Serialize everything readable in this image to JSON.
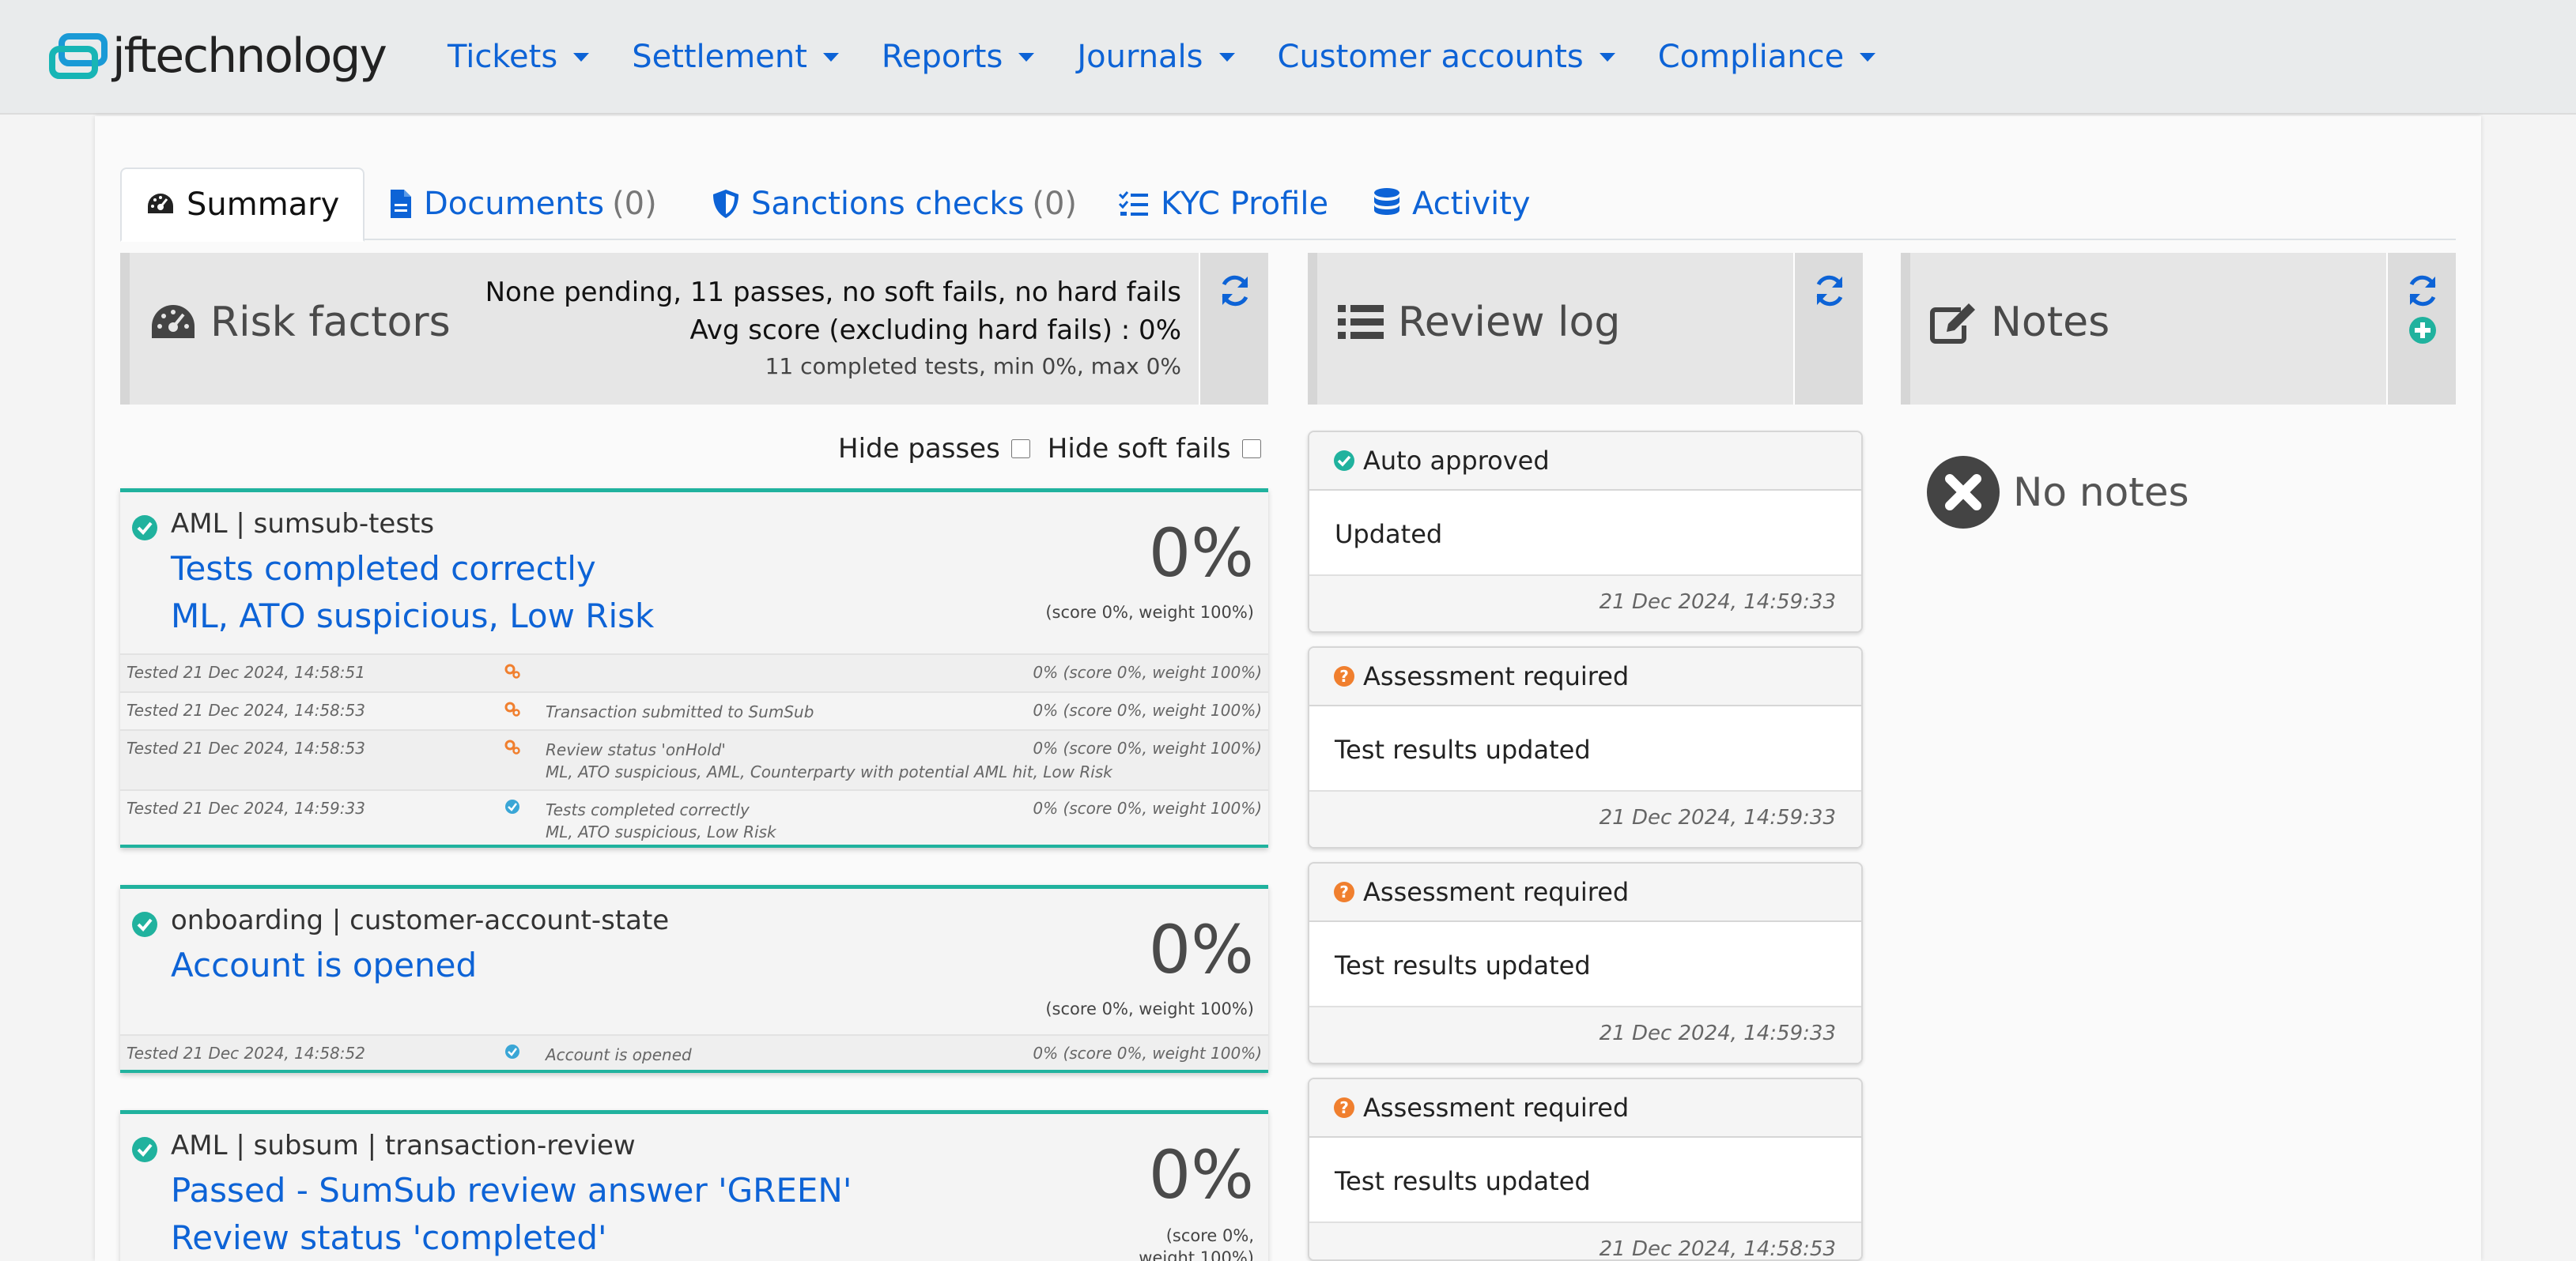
{
  "brand": {
    "name": "jftechnology"
  },
  "nav": {
    "items": [
      {
        "label": "Tickets"
      },
      {
        "label": "Settlement"
      },
      {
        "label": "Reports"
      },
      {
        "label": "Journals"
      },
      {
        "label": "Customer accounts"
      },
      {
        "label": "Compliance"
      }
    ]
  },
  "tabs": [
    {
      "label": "Summary",
      "icon": "tachometer-icon",
      "count": ""
    },
    {
      "label": "Documents",
      "icon": "file-icon",
      "count": "(0)"
    },
    {
      "label": "Sanctions checks",
      "icon": "shield-icon",
      "count": "(0)"
    },
    {
      "label": "KYC Profile",
      "icon": "checklist-icon",
      "count": ""
    },
    {
      "label": "Activity",
      "icon": "database-icon",
      "count": ""
    }
  ],
  "risk": {
    "title": "Risk factors",
    "summary_line1": "None pending, 11 passes, no soft fails, no hard fails",
    "summary_line2": "Avg score (excluding hard fails) : 0%",
    "summary_line3": "11 completed tests, min 0%, max 0%",
    "filters": {
      "hide_passes": "Hide passes",
      "hide_soft_fails": "Hide soft fails"
    },
    "cards": [
      {
        "source": "AML | sumsub-tests",
        "lines": [
          "Tests completed correctly",
          "ML, ATO suspicious, Low Risk"
        ],
        "percent": "0%",
        "weight": "(score 0%, weight 100%)",
        "tests": [
          {
            "time": "Tested 21 Dec 2024, 14:58:51",
            "status": "pending",
            "desc1": "",
            "desc2": "",
            "score": "0% (score 0%, weight 100%)"
          },
          {
            "time": "Tested 21 Dec 2024, 14:58:53",
            "status": "pending",
            "desc1": "Transaction submitted to SumSub",
            "desc2": "",
            "score": "0% (score 0%, weight 100%)"
          },
          {
            "time": "Tested 21 Dec 2024, 14:58:53",
            "status": "pending",
            "desc1": "Review status 'onHold'",
            "desc2": "ML, ATO suspicious, AML, Counterparty with potential AML hit, Low Risk",
            "score": "0% (score 0%, weight 100%)"
          },
          {
            "time": "Tested 21 Dec 2024, 14:59:33",
            "status": "pass",
            "desc1": "Tests completed correctly",
            "desc2": "ML, ATO suspicious, Low Risk",
            "score": "0% (score 0%, weight 100%)"
          }
        ]
      },
      {
        "source": "onboarding | customer-account-state",
        "lines": [
          "Account is opened"
        ],
        "percent": "0%",
        "weight": "(score 0%, weight 100%)",
        "tests": [
          {
            "time": "Tested 21 Dec 2024, 14:58:52",
            "status": "pass",
            "desc1": "Account is opened",
            "desc2": "",
            "score": "0% (score 0%, weight 100%)"
          }
        ]
      },
      {
        "source": "AML | subsum | transaction-review",
        "lines": [
          "Passed - SumSub review answer 'GREEN'",
          "Review status 'completed'"
        ],
        "percent": "0%",
        "weight_line1": "(score 0%,",
        "weight_line2": "weight 100%)"
      }
    ]
  },
  "review_log": {
    "title": "Review log",
    "entries": [
      {
        "status": "Auto approved",
        "status_icon": "check-circle-icon",
        "body": "Updated",
        "time": "21 Dec 2024, 14:59:33"
      },
      {
        "status": "Assessment required",
        "status_icon": "question-circle-icon",
        "body": "Test results updated",
        "time": "21 Dec 2024, 14:59:33"
      },
      {
        "status": "Assessment required",
        "status_icon": "question-circle-icon",
        "body": "Test results updated",
        "time": "21 Dec 2024, 14:59:33"
      },
      {
        "status": "Assessment required",
        "status_icon": "question-circle-icon",
        "body": "Test results updated",
        "time": "21 Dec 2024, 14:58:53"
      }
    ]
  },
  "notes": {
    "title": "Notes",
    "empty_text": "No notes"
  },
  "colors": {
    "brand_blue": "#0d63d6",
    "teal": "#20b29e",
    "orange": "#f07f2e",
    "gray_header": "#e6e6e6"
  }
}
